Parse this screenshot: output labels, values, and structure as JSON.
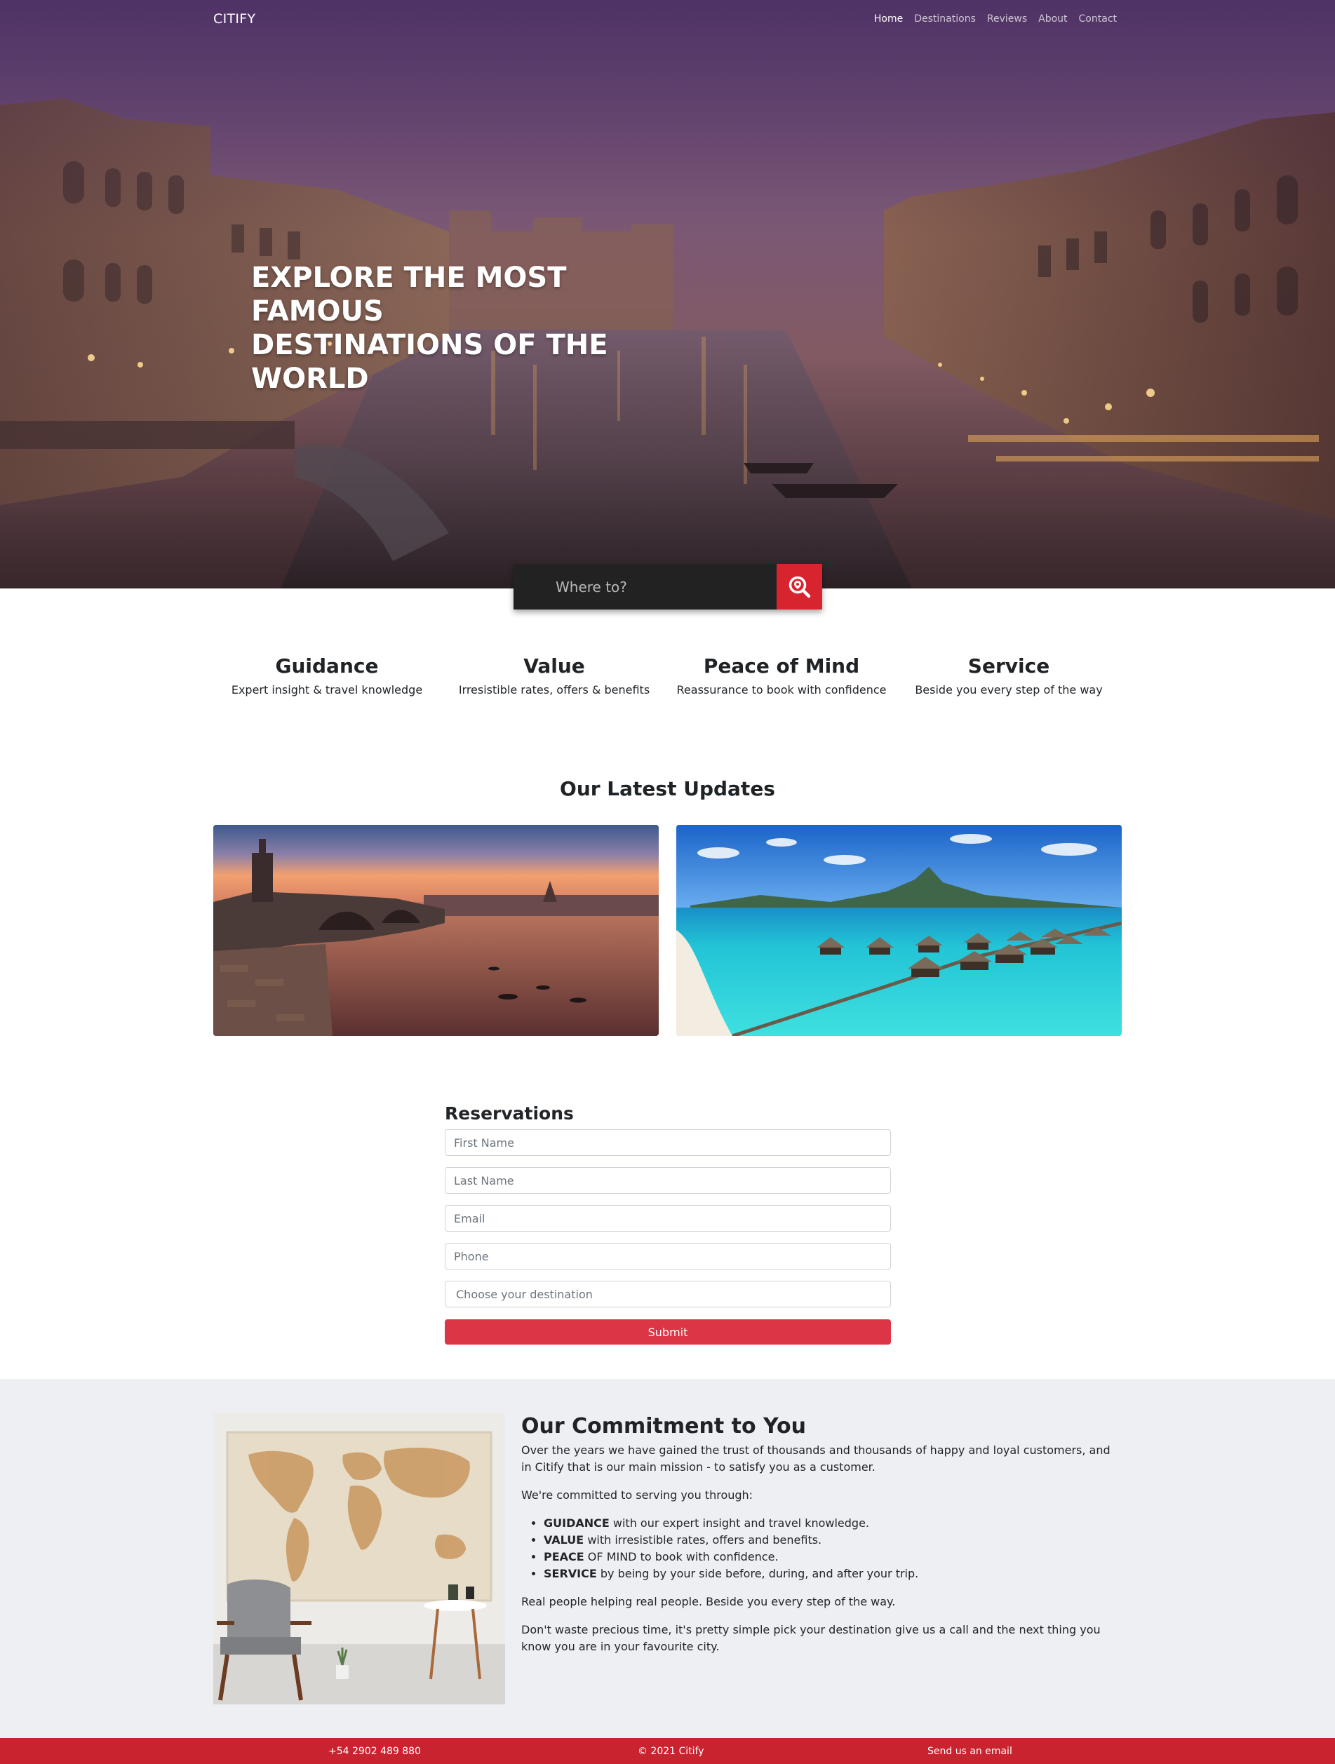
{
  "nav": {
    "brand": "CITIFY",
    "links": [
      "Home",
      "Destinations",
      "Reviews",
      "About",
      "Contact"
    ],
    "active": "Home"
  },
  "hero": {
    "title_lines": [
      "EXPLORE THE MOST FAMOUS",
      "DESTINATIONS OF THE",
      "WORLD"
    ]
  },
  "search": {
    "placeholder": "Where to?",
    "icon": "search-location-icon"
  },
  "features": [
    {
      "title": "Guidance",
      "text": "Expert insight & travel knowledge"
    },
    {
      "title": "Value",
      "text": "Irresistible rates, offers & benefits"
    },
    {
      "title": "Peace of Mind",
      "text": "Reassurance to book with confidence"
    },
    {
      "title": "Service",
      "text": "Beside you every step of the way"
    }
  ],
  "updates": {
    "title": "Our Latest Updates"
  },
  "reservations": {
    "title": "Reservations",
    "first_name_placeholder": "First Name",
    "last_name_placeholder": "Last Name",
    "email_placeholder": "Email",
    "phone_placeholder": "Phone",
    "destination_placeholder": "Choose your destination",
    "submit_label": "Submit"
  },
  "commitment": {
    "title": "Our Commitment to You",
    "p1": "Over the years we have gained the trust of thousands and thousands of happy and loyal customers, and in Citify that is our main mission - to satisfy you as a customer.",
    "p2": "We're committed to serving you through:",
    "items": [
      {
        "bold": "GUIDANCE",
        "rest": " with our expert insight and travel knowledge."
      },
      {
        "bold": "VALUE",
        "rest": " with irresistible rates, offers and benefits."
      },
      {
        "bold": "PEACE",
        "rest": " OF MIND to book with confidence."
      },
      {
        "bold": "SERVICE",
        "rest": " by being by your side before, during, and after your trip."
      }
    ],
    "p3": "Real people helping real people. Beside you every step of the way.",
    "p4": "Don't waste precious time, it's pretty simple pick your destination give us a call and the next thing you know you are in your favourite city."
  },
  "footer": {
    "phone": "+54 2902 489 880",
    "copyright": "© 2021 Citify",
    "email_link": "Send us an email"
  },
  "colors": {
    "accent": "#dc3545",
    "footer": "#c8232e",
    "search_bg": "#222222",
    "commit_bg": "#eeeff2"
  }
}
